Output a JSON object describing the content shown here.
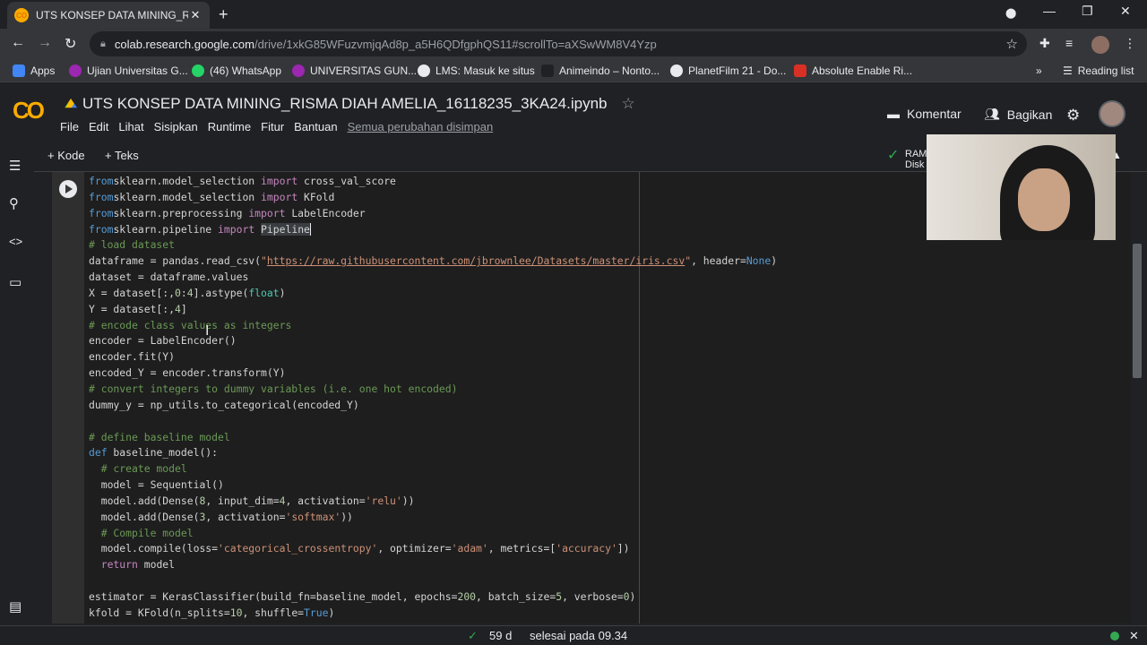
{
  "browser": {
    "tab_title": "UTS KONSEP DATA MINING_RISM",
    "tab_favicon": "CO",
    "new_tab": "+",
    "url_domain": "colab.research.google.com",
    "url_path": "/drive/1xkG85WFuzvmjqAd8p_a5H6QDfgphQS11#scrollTo=aXSwWM8V4Yzp",
    "bookmarks": [
      {
        "label": "Apps",
        "color": "#4285f4"
      },
      {
        "label": "Ujian Universitas G...",
        "color": "#9c27b0"
      },
      {
        "label": "(46) WhatsApp",
        "color": "#25d366"
      },
      {
        "label": "UNIVERSITAS GUN...",
        "color": "#9c27b0"
      },
      {
        "label": "LMS: Masuk ke situs",
        "color": "#e8eaed"
      },
      {
        "label": "Animeindo – Nonto...",
        "color": "#202124"
      },
      {
        "label": "PlanetFilm 21 - Do...",
        "color": "#e8eaed"
      },
      {
        "label": "Absolute Enable Ri...",
        "color": "#d93025"
      }
    ],
    "bookmark_overflow": "»",
    "reading_list": "Reading list"
  },
  "colab": {
    "logo": "CO",
    "notebook_title": "UTS KONSEP DATA MINING_RISMA DIAH AMELIA_16118235_3KA24.ipynb",
    "menu": [
      "File",
      "Edit",
      "Lihat",
      "Sisipkan",
      "Runtime",
      "Fitur",
      "Bantuan"
    ],
    "saved_status": "Semua perubahan disimpan",
    "comment_label": "Komentar",
    "share_label": "Bagikan",
    "add_code": "+ Kode",
    "add_text": "+ Teks",
    "ram_label": "RAM",
    "disk_label": "Disk"
  },
  "code_lines": [
    [
      [
        "kw",
        "from"
      ],
      [
        "",
        "sklearn.model_selection "
      ],
      [
        "ps",
        "import"
      ],
      [
        "",
        " cross_val_score"
      ]
    ],
    [
      [
        "kw",
        "from"
      ],
      [
        "",
        "sklearn.model_selection "
      ],
      [
        "ps",
        "import"
      ],
      [
        "",
        " KFold"
      ]
    ],
    [
      [
        "kw",
        "from"
      ],
      [
        "",
        "sklearn.preprocessing "
      ],
      [
        "ps",
        "import"
      ],
      [
        "",
        " LabelEncoder"
      ]
    ],
    [
      [
        "kw",
        "from"
      ],
      [
        "",
        "sklearn.pipeline "
      ],
      [
        "ps",
        "import"
      ],
      [
        "",
        " "
      ],
      [
        "hl",
        "Pipeline"
      ]
    ],
    [
      [
        "cm",
        "# load dataset"
      ]
    ],
    [
      [
        "",
        "dataframe = pandas.read_csv("
      ],
      [
        "st",
        "\""
      ],
      [
        "url",
        "https://raw.githubusercontent.com/jbrownlee/Datasets/master/iris.csv"
      ],
      [
        "st",
        "\""
      ],
      [
        "",
        ", header="
      ],
      [
        "kw",
        "None"
      ],
      [
        "",
        ")"
      ]
    ],
    [
      [
        "",
        "dataset = dataframe.values"
      ]
    ],
    [
      [
        "",
        "X = dataset[:,"
      ],
      [
        "nm",
        "0"
      ],
      [
        "",
        ":"
      ],
      [
        "nm",
        "4"
      ],
      [
        "",
        "].astype("
      ],
      [
        "bi",
        "float"
      ],
      [
        "",
        ")"
      ]
    ],
    [
      [
        "",
        "Y = dataset[:,"
      ],
      [
        "nm",
        "4"
      ],
      [
        "",
        "]"
      ]
    ],
    [
      [
        "cm",
        "# encode class values as integers"
      ]
    ],
    [
      [
        "",
        "encoder = LabelEncoder()"
      ]
    ],
    [
      [
        "",
        "encoder.fit(Y)"
      ]
    ],
    [
      [
        "",
        "encoded_Y = encoder.transform(Y)"
      ]
    ],
    [
      [
        "cm",
        "# convert integers to dummy variables (i.e. one hot encoded)"
      ]
    ],
    [
      [
        "",
        "dummy_y = np_utils.to_categorical(encoded_Y)"
      ]
    ],
    [
      [
        "",
        ""
      ]
    ],
    [
      [
        "cm",
        "# define baseline model"
      ]
    ],
    [
      [
        "kw",
        "def"
      ],
      [
        "",
        " baseline_model():"
      ]
    ],
    [
      [
        "cm",
        "  # create model"
      ]
    ],
    [
      [
        "",
        "  model = Sequential()"
      ]
    ],
    [
      [
        "",
        "  model.add(Dense("
      ],
      [
        "nm",
        "8"
      ],
      [
        "",
        ", input_dim="
      ],
      [
        "nm",
        "4"
      ],
      [
        "",
        ", activation="
      ],
      [
        "st",
        "'relu'"
      ],
      [
        "",
        "))"
      ]
    ],
    [
      [
        "",
        "  model.add(Dense("
      ],
      [
        "nm",
        "3"
      ],
      [
        "",
        ", activation="
      ],
      [
        "st",
        "'softmax'"
      ],
      [
        "",
        "))"
      ]
    ],
    [
      [
        "cm",
        "  # Compile model"
      ]
    ],
    [
      [
        "",
        "  model.compile(loss="
      ],
      [
        "st",
        "'categorical_crossentropy'"
      ],
      [
        "",
        ", optimizer="
      ],
      [
        "st",
        "'adam'"
      ],
      [
        "",
        ", metrics=["
      ],
      [
        "st",
        "'accuracy'"
      ],
      [
        "",
        "])"
      ]
    ],
    [
      [
        "",
        "  "
      ],
      [
        "ps",
        "return"
      ],
      [
        "",
        " model"
      ]
    ],
    [
      [
        "",
        ""
      ]
    ],
    [
      [
        "",
        "estimator = KerasClassifier(build_fn=baseline_model, epochs="
      ],
      [
        "nm",
        "200"
      ],
      [
        "",
        ", batch_size="
      ],
      [
        "nm",
        "5"
      ],
      [
        "",
        ", verbose="
      ],
      [
        "nm",
        "0"
      ],
      [
        "",
        ")"
      ]
    ],
    [
      [
        "",
        "kfold = KFold(n_splits="
      ],
      [
        "nm",
        "10"
      ],
      [
        "",
        ", shuffle="
      ],
      [
        "kw",
        "True"
      ],
      [
        "",
        ")"
      ]
    ]
  ],
  "status": {
    "check": "✓",
    "elapsed": "59 d",
    "finished": "selesai pada 09.34"
  }
}
